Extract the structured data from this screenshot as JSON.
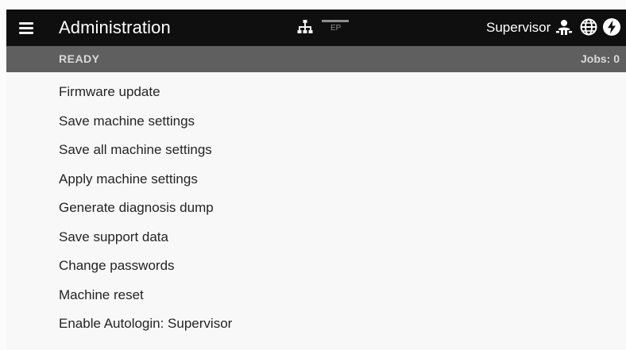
{
  "header": {
    "title": "Administration",
    "network_icon": "network-tree-icon",
    "ep_label": "EP",
    "user": "Supervisor",
    "icons": [
      "user-icon",
      "globe-icon",
      "power-icon"
    ]
  },
  "status": {
    "state": "READY",
    "jobs": "Jobs: 0"
  },
  "menu": {
    "items": [
      {
        "label": "Firmware update"
      },
      {
        "label": "Save machine settings"
      },
      {
        "label": "Save all machine settings"
      },
      {
        "label": "Apply machine settings"
      },
      {
        "label": "Generate diagnosis dump"
      },
      {
        "label": "Save support data"
      },
      {
        "label": "Change passwords"
      },
      {
        "label": "Machine reset"
      },
      {
        "label": "Enable Autologin: Supervisor"
      }
    ]
  },
  "colors": {
    "titlebar": "#0f0f0f",
    "statusbar": "#5f5f5f",
    "background": "#f8f8f8",
    "text": "#242424"
  }
}
